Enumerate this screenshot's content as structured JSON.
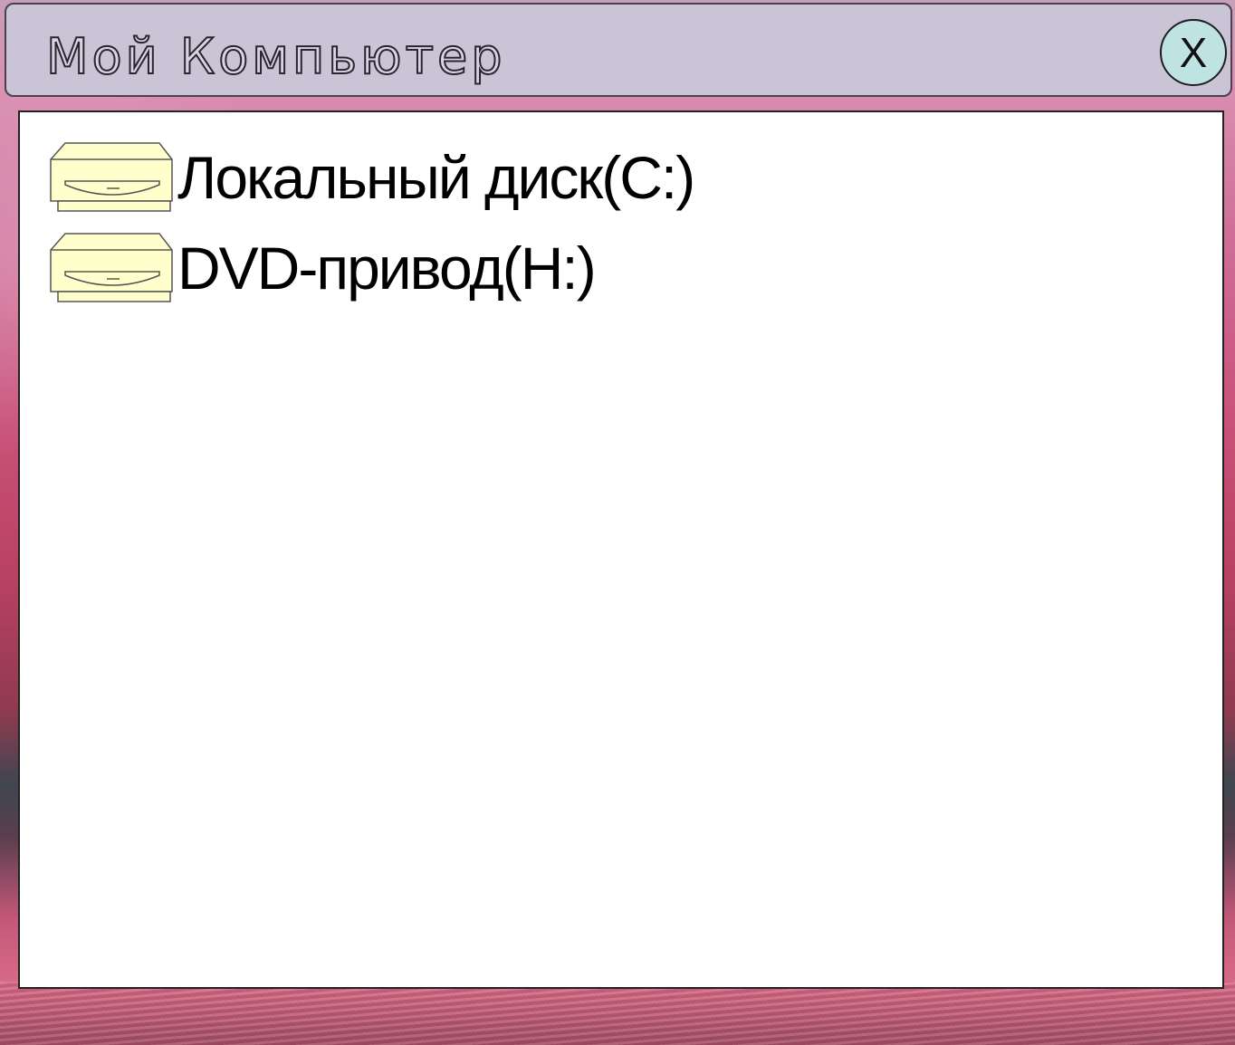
{
  "window": {
    "title": "Мой Компьютер",
    "close_label": "X"
  },
  "drives": [
    {
      "label": "Локальный диск(C:)",
      "icon": "drive-icon"
    },
    {
      "label": "DVD-привод(H:)",
      "icon": "drive-icon"
    }
  ],
  "colors": {
    "title_bar_bg": "#c9c4d6",
    "close_button_bg": "#bfe3e3",
    "content_bg": "#ffffff",
    "drive_icon_fill": "#ffffcc"
  }
}
